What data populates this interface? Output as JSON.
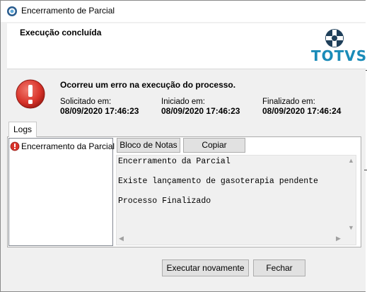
{
  "window": {
    "title": "Encerramento de Parcial"
  },
  "header": {
    "title": "Execução concluída",
    "brand": "TOTVS"
  },
  "status": {
    "message": "Ocorreu um erro na execução do processo.",
    "requested_label": "Solicitado em:",
    "requested_value": "08/09/2020 17:46:23",
    "started_label": "Iniciado em:",
    "started_value": "08/09/2020 17:46:23",
    "finished_label": "Finalizado em:",
    "finished_value": "08/09/2020 17:46:24"
  },
  "tabs": [
    {
      "label": "Logs"
    }
  ],
  "log_list": {
    "items": [
      {
        "label": "Encerramento da Parcial"
      }
    ]
  },
  "log_actions": {
    "notepad_label": "Bloco de Notas",
    "copy_label": "Copiar"
  },
  "log_text": {
    "lines": [
      "Encerramento da Parcial",
      "Existe lançamento de gasoterapia pendente",
      "Processo Finalizado"
    ]
  },
  "footer": {
    "run_again_label": "Executar novamente",
    "close_label": "Fechar"
  },
  "colors": {
    "brand": "#1a8bb8",
    "error": "#d9342b"
  },
  "icons": {
    "app": "app-icon",
    "error": "error-icon",
    "log_item": "log-error-icon"
  }
}
